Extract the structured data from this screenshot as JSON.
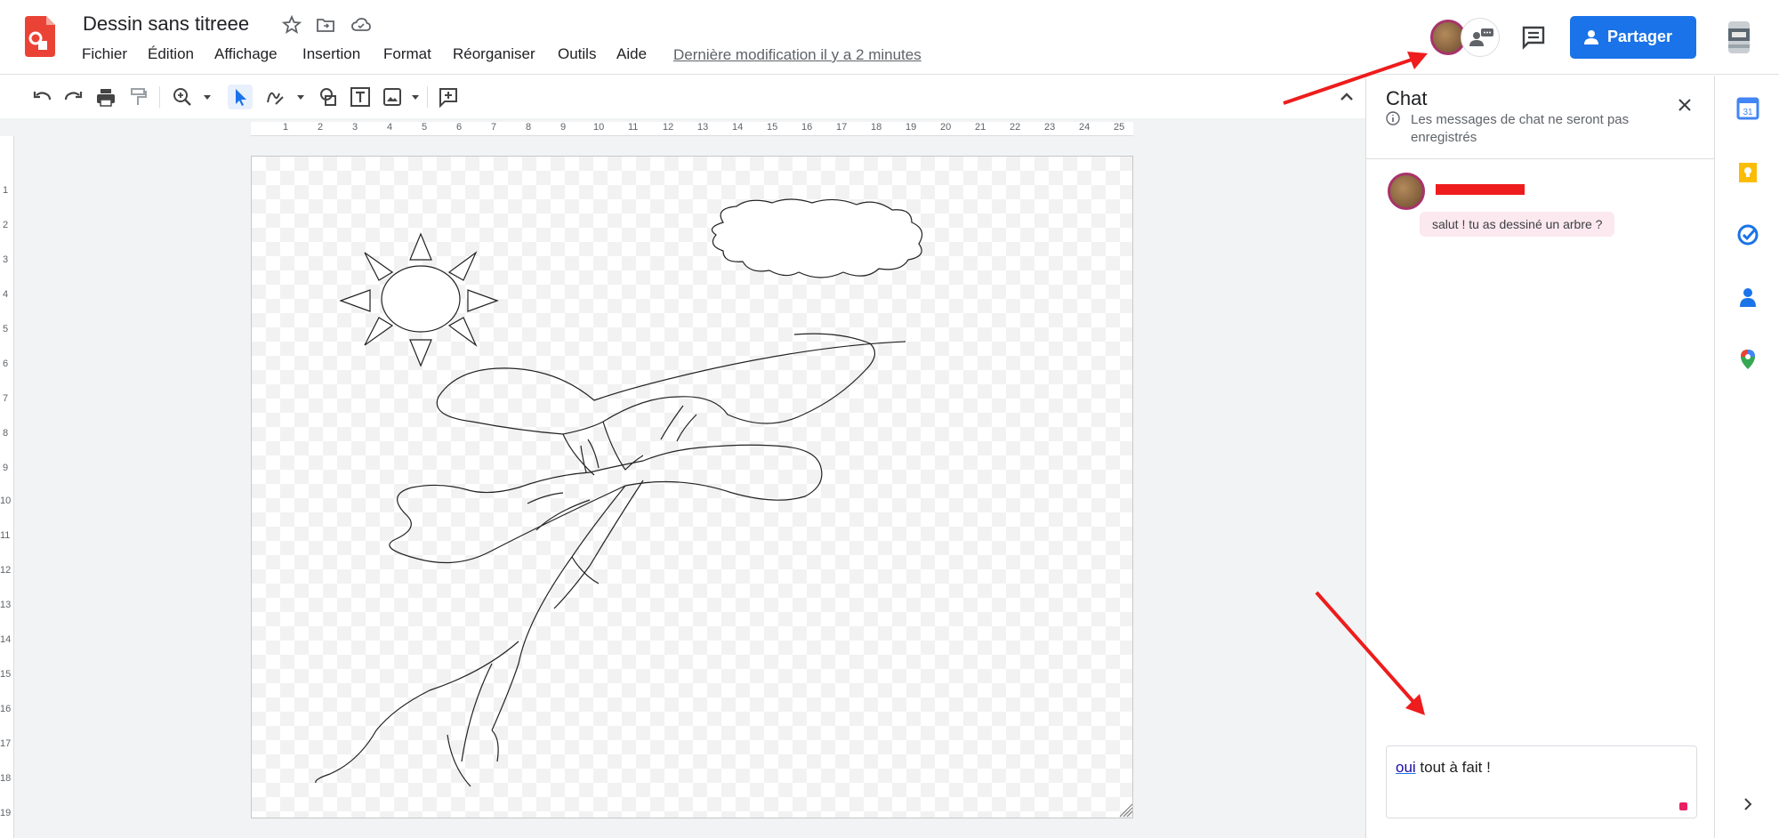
{
  "document": {
    "title": "Dessin sans titreee",
    "last_edit": "Dernière modification il y a 2 minutes"
  },
  "menu": [
    "Fichier",
    "Édition",
    "Affichage",
    "Insertion",
    "Format",
    "Réorganiser",
    "Outils",
    "Aide"
  ],
  "header": {
    "share_label": "Partager"
  },
  "ruler": {
    "top": [
      "1",
      "2",
      "3",
      "4",
      "5",
      "6",
      "7",
      "8",
      "9",
      "10",
      "11",
      "12",
      "13",
      "14",
      "15",
      "16",
      "17",
      "18",
      "19",
      "20",
      "21",
      "22",
      "23",
      "24",
      "25"
    ],
    "left": [
      "1",
      "2",
      "3",
      "4",
      "5",
      "6",
      "7",
      "8",
      "9",
      "10",
      "11",
      "12",
      "13",
      "14",
      "15",
      "16",
      "17",
      "18",
      "19"
    ]
  },
  "chat": {
    "title": "Chat",
    "notice": "Les messages de chat ne seront pas enregistrés",
    "messages": [
      {
        "text": "salut ! tu as dessiné un arbre ?"
      }
    ],
    "input_word_misspelled": "oui",
    "input_rest": " tout à fait !"
  },
  "colors": {
    "brand": "#1a73e8",
    "app_logo": "#ea4335",
    "avatar_ring": "#a7336b",
    "chat_bubble": "#fce8ef",
    "annotation_arrow": "#ee1c1c"
  },
  "side_panel_icons": [
    "calendar-icon",
    "keep-icon",
    "tasks-icon",
    "contacts-icon",
    "maps-icon",
    "expand-icon"
  ]
}
